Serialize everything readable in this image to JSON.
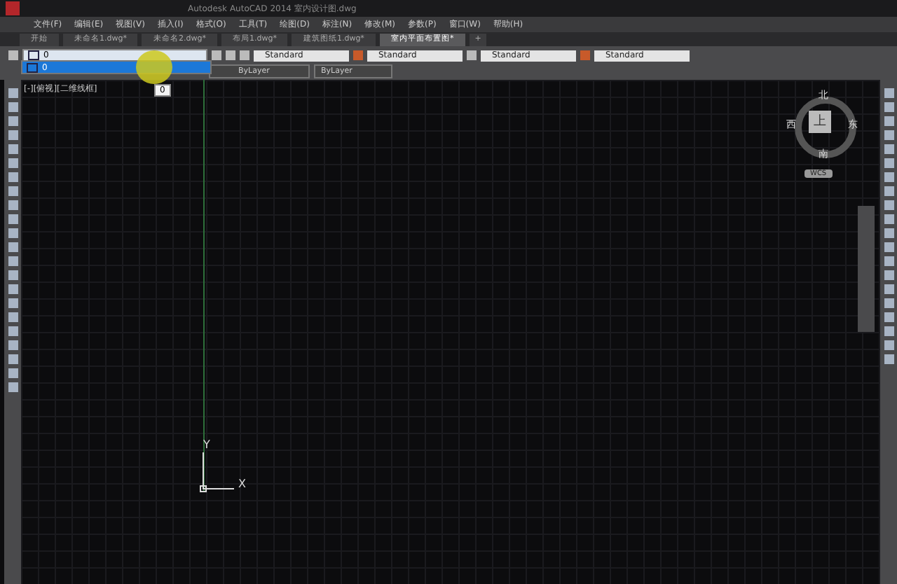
{
  "window": {
    "title": "Autodesk AutoCAD 2014    室内设计图.dwg"
  },
  "menu": [
    "文件(F)",
    "编辑(E)",
    "视图(V)",
    "插入(I)",
    "格式(O)",
    "工具(T)",
    "绘图(D)",
    "标注(N)",
    "修改(M)",
    "参数(P)",
    "窗口(W)",
    "帮助(H)"
  ],
  "tabs": [
    {
      "label": "开始",
      "selected": false
    },
    {
      "label": "未命名1.dwg*",
      "selected": false
    },
    {
      "label": "未命名2.dwg*",
      "selected": false
    },
    {
      "label": "布局1.dwg*",
      "selected": false
    },
    {
      "label": "建筑图纸1.dwg*",
      "selected": false
    },
    {
      "label": "室内平面布置图*",
      "selected": true
    }
  ],
  "new_tab_button": "+",
  "layer_dropdown": {
    "value": "0",
    "options": [
      {
        "label": "0",
        "selected": true
      }
    ]
  },
  "style_fields": [
    "Standard",
    "Standard",
    "Standard",
    "Standard"
  ],
  "property_fields": [
    "ByLayer",
    "ByLayer"
  ],
  "tooltip": "0",
  "viewport_label": "[-][俯视][二维线框]",
  "viewcube": {
    "north": "北",
    "south": "南",
    "east": "东",
    "west": "西",
    "face": "上",
    "ucs": "WCS"
  },
  "ucs": {
    "x": "X",
    "y": "Y"
  }
}
